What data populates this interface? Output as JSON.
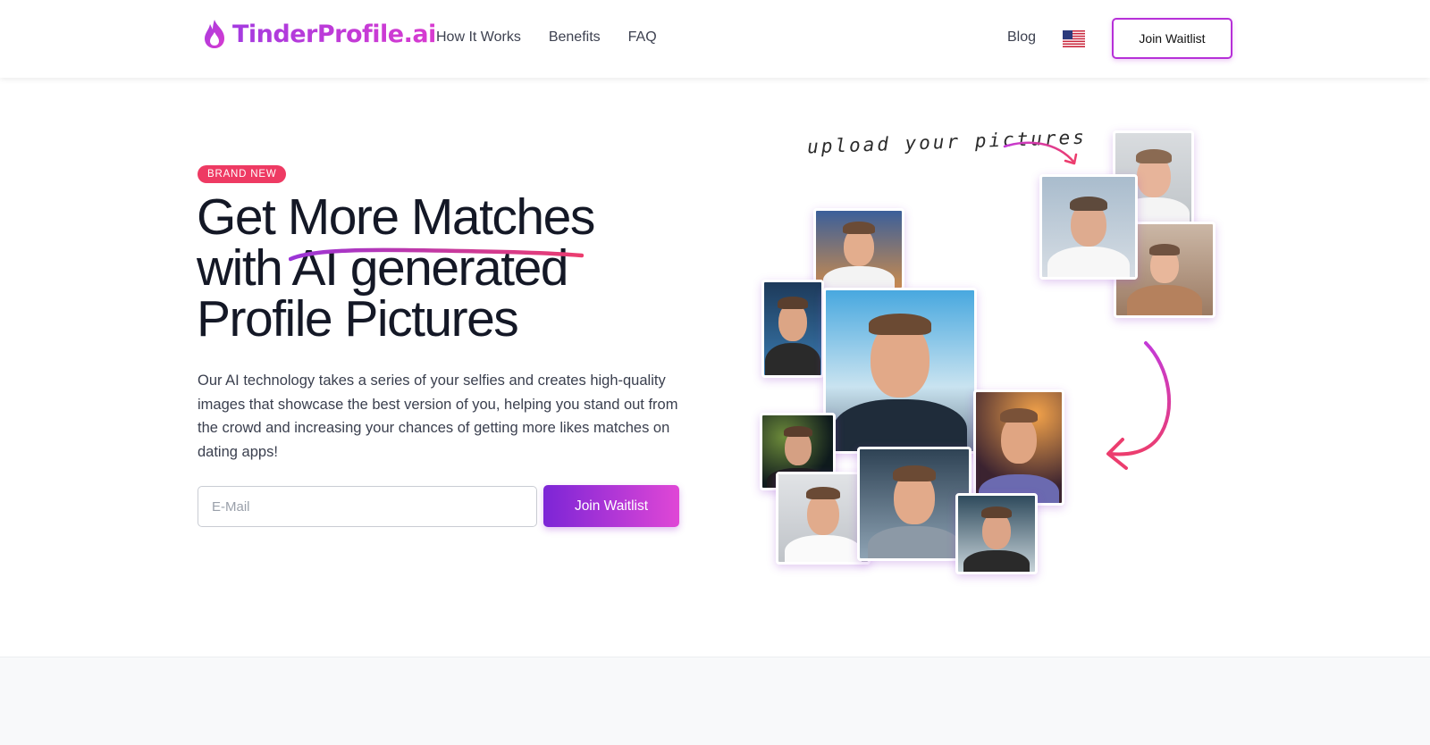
{
  "brand": {
    "name": "TinderProfile.ai",
    "gradient": [
      "#a43be0",
      "#d83bd0"
    ]
  },
  "nav": {
    "items": [
      "How It Works",
      "Benefits",
      "FAQ"
    ],
    "blog": "Blog",
    "join": "Join Waitlist"
  },
  "hero": {
    "badge": "BRAND NEW",
    "headline": [
      "Get More Matches",
      "with AI generated",
      "Profile Pictures"
    ],
    "description": "Our AI technology takes a series of your selfies and creates high-quality images that showcase the best version of you, helping you stand out from the crowd and increasing your chances of getting more likes matches on dating apps!",
    "email_placeholder": "E-Mail",
    "cta": "Join Waitlist"
  },
  "illustration": {
    "upload_caption": "upload your pictures"
  },
  "colors": {
    "accent": "#b630d8",
    "badge": "#ee3a63",
    "text": "#141826"
  }
}
